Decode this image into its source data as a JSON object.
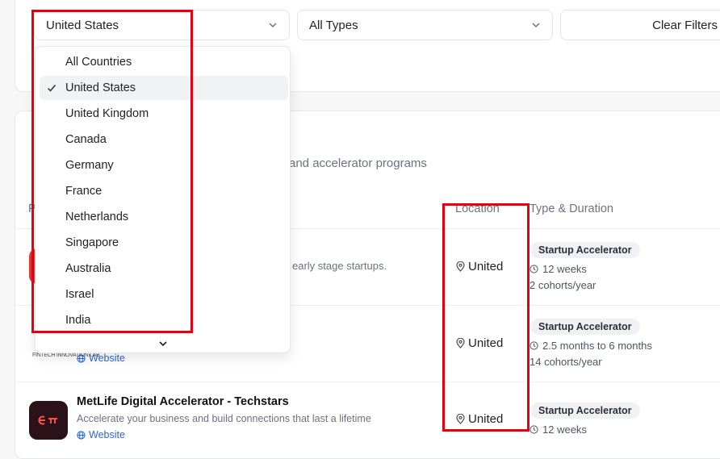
{
  "filters": {
    "country_select": "United States",
    "type_select": "All Types",
    "clear_label": "Clear Filters"
  },
  "table": {
    "description_fragment": "and accelerator programs",
    "columns": {
      "program_fragment": "P",
      "location": "Location",
      "type_duration": "Type & Duration"
    },
    "rows": [
      {
        "description_fragment": "early stage startups.",
        "location": "United",
        "type": "Startup Accelerator",
        "duration": "12 weeks",
        "cohorts": "2 cohorts/year"
      },
      {
        "logo_text": "FINTECH INNOVATION LAB",
        "website": "Website",
        "location": "United",
        "type": "Startup Accelerator",
        "duration": "2.5 months to 6 months",
        "cohorts": "14 cohorts/year"
      },
      {
        "title": "MetLife Digital Accelerator - Techstars",
        "description": "Accelerate your business and build connections that last a lifetime",
        "website": "Website",
        "location": "United",
        "type": "Startup Accelerator",
        "duration": "12 weeks"
      }
    ]
  },
  "dropdown": {
    "options": [
      "All Countries",
      "United States",
      "United Kingdom",
      "Canada",
      "Germany",
      "France",
      "Netherlands",
      "Singapore",
      "Australia",
      "Israel",
      "India"
    ],
    "selected": "United States"
  },
  "colors": {
    "highlight": "#e60012",
    "link": "#2e63d6",
    "metlife_logo_bg": "#2a1218",
    "red_logo": "#e23a3a"
  },
  "icons": [
    "chevron-down-icon",
    "check-icon",
    "map-pin-icon",
    "clock-icon",
    "globe-icon"
  ]
}
